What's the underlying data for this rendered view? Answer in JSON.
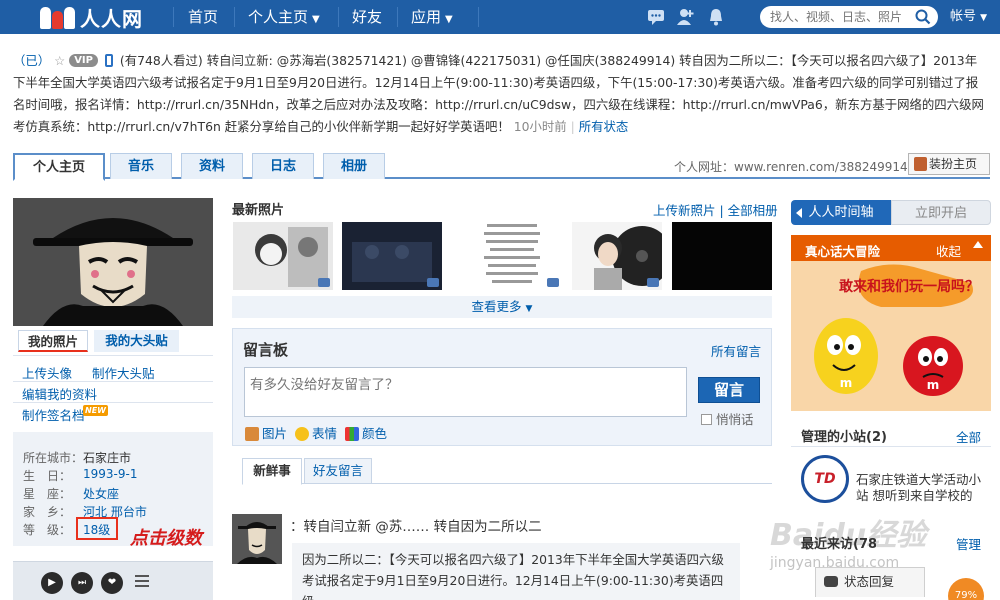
{
  "nav": {
    "logo": "人人网",
    "items": [
      "首页",
      "个人主页",
      "好友",
      "应用"
    ],
    "search_placeholder": "找人、视频、日志、照片",
    "account": "帐号"
  },
  "status": {
    "name": "（已）",
    "views": "(有748人看过)",
    "text": "转自闫立新: @苏海岩(382571421) @曹锦锋(422175031) @任国庆(388249914) 转自因为二所以二：【今天可以报名四六级了】2013年下半年全国大学英语四六级考试报名定于9月1日至9月20日进行。12月14日上午(9:00-11:30)考英语四级，下午(15:00-17:30)考英语六级。准备考四六级的同学可别错过了报名时间哦，报名详情：http://rrurl.cn/35NHdn，改革之后应对办法及攻略：http://rrurl.cn/uC9dsw，四六级在线课程：http://rrurl.cn/mwVPa6，新东方基于网络的四六级网考仿真系统：http://rrurl.cn/v7hT6n 赶紧分享给自己的小伙伴新学期一起好好学英语吧！",
    "vip": "VIP",
    "time": "10小时前",
    "all": "所有状态"
  },
  "tabs": [
    "个人主页",
    "音乐",
    "资料",
    "日志",
    "相册"
  ],
  "personal_url": "个人网址：www.renren.com/388249914",
  "dressup": "装扮主页",
  "left": {
    "photo_tabs": [
      "我的照片",
      "我的大头贴"
    ],
    "links": [
      "上传头像",
      "制作大头贴",
      "编辑我的资料",
      "制作签名档"
    ],
    "new_badge": "NEW",
    "profile": [
      {
        "label": "所在城市：",
        "value": "石家庄市"
      },
      {
        "label": "生　日：",
        "value": "1993-9-1"
      },
      {
        "label": "星　座：",
        "value": "处女座"
      },
      {
        "label": "家　乡：",
        "value": "河北 邢台市"
      },
      {
        "label": "等　级：",
        "value": "18级"
      }
    ],
    "annotation": "点击级数"
  },
  "photos": {
    "title": "最新照片",
    "links": "上传新照片 | 全部相册",
    "more": "查看更多"
  },
  "msgboard": {
    "title": "留言板",
    "all": "所有留言",
    "placeholder": "有多久没给好友留言了？",
    "submit": "留言",
    "quiet": "悄悄话",
    "tools": [
      "图片",
      "表情",
      "颜色"
    ]
  },
  "feed_tabs": [
    "新鲜事",
    "好友留言"
  ],
  "feed": {
    "head": "：转自闫立新 @苏…… 转自因为二所以二",
    "link": "因为二所以二",
    "body": "因为二所以二：【今天可以报名四六级了】2013年下半年全国大学英语四六级考试报名定于9月1日至9月20日进行。12月14日上午(9:00-11:30)考英语四级，"
  },
  "right": {
    "timeline": "人人时间轴",
    "open": "立即开启",
    "ad_title": "真心话大冒险",
    "ad_fold": "收起",
    "ad_slogan": "敢来和我们玩一局吗？",
    "sites_title": "管理的小站(2)",
    "sites_all": "全部",
    "site_logo": "TD",
    "site_name": "石家庄铁道大学活动小站 想听到来自学校的",
    "recent_title": "最近来访(78",
    "recent_mgr": "管理",
    "chat": "状态回复",
    "progress": "79%",
    "watermark": "Baidu经验",
    "watermark_sub": "jingyan.baidu.com"
  }
}
